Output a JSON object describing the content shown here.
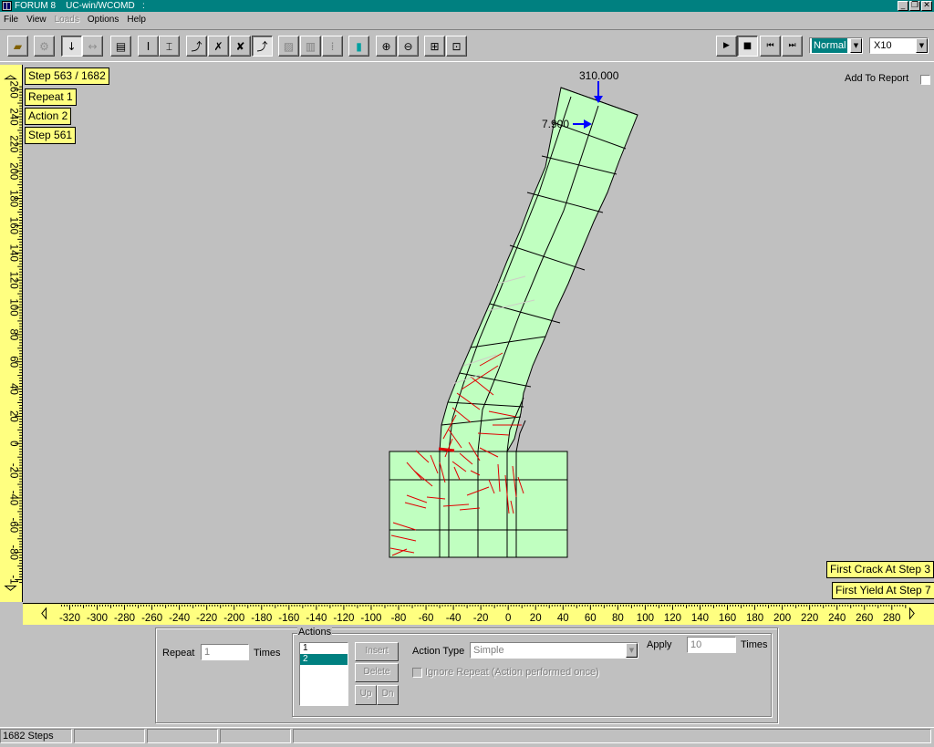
{
  "window": {
    "brand": "FORUM 8",
    "app": "UC-win/WCOMD",
    "sep": ":"
  },
  "menu": [
    "File",
    "View",
    "Loads",
    "Options",
    "Help"
  ],
  "toolbar": {
    "speed_mode": "Normal",
    "speed_factor": "X10"
  },
  "overlay": {
    "step": "Step 563 / 1682",
    "repeat": "Repeat 1",
    "action": "Action 2",
    "current_step": "Step 561",
    "add_to_report": "Add To Report",
    "first_crack": "First Crack At Step 3",
    "first_yield": "First Yield At Step 7"
  },
  "loads": {
    "vertical": "310.000",
    "horizontal": "7.900"
  },
  "rulers": {
    "vertical_ticks": [
      "260",
      "240",
      "220",
      "200",
      "180",
      "160",
      "140",
      "120",
      "100",
      "80",
      "60",
      "40",
      "20",
      "0",
      "-20",
      "-40",
      "-60",
      "-80",
      "-1"
    ],
    "horizontal_ticks": [
      "-320",
      "-300",
      "-280",
      "-260",
      "-240",
      "-220",
      "-200",
      "-180",
      "-160",
      "-140",
      "-120",
      "-100",
      "-80",
      "-60",
      "-40",
      "-20",
      "0",
      "20",
      "40",
      "60",
      "80",
      "100",
      "120",
      "140",
      "160",
      "180",
      "200",
      "220",
      "240",
      "260",
      "280"
    ]
  },
  "panel": {
    "repeat_label": "Repeat",
    "repeat_value": "1",
    "times_label": "Times",
    "actions_label": "Actions",
    "actions": [
      "1",
      "2"
    ],
    "selected_action": "2",
    "insert": "Insert",
    "delete": "Delete",
    "up": "Up",
    "down": "Dn",
    "action_type_label": "Action Type",
    "action_type_value": "Simple",
    "ignore_repeat": "Ignore Repeat (Action performed once)",
    "apply_label": "Apply",
    "apply_value": "10",
    "apply_times_label": "Times"
  },
  "status": {
    "steps": "1682 Steps"
  },
  "colors": {
    "teal": "#008080",
    "ruler": "#ffff80",
    "mesh": "#c0ffc0",
    "crack": "#ff0000",
    "load_arrow": "#0000ff"
  }
}
